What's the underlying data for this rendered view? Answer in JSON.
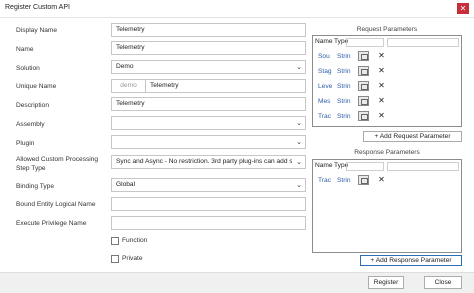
{
  "window": {
    "title": "Register Custom API",
    "close_symbol": "✕"
  },
  "form": {
    "display_name": {
      "label": "Display Name",
      "value": "Telemetry"
    },
    "name": {
      "label": "Name",
      "value": "Telemetry"
    },
    "solution": {
      "label": "Solution",
      "value": "Demo"
    },
    "unique_name": {
      "label": "Unique Name",
      "prefix": "demo",
      "value": "Telemetry"
    },
    "description": {
      "label": "Description",
      "value": "Telemetry"
    },
    "assembly": {
      "label": "Assembly",
      "value": ""
    },
    "plugin": {
      "label": "Plugin",
      "value": ""
    },
    "processing_step": {
      "label_line1": "Allowed Custom Processing",
      "label_line2": "Step Type",
      "value": "Sync and Async - No restriction. 3rd party plug-ins can add s"
    },
    "binding_type": {
      "label": "Binding Type",
      "value": "Global"
    },
    "bound_entity": {
      "label": "Bound Entity Logical Name",
      "value": ""
    },
    "execute_privilege": {
      "label": "Execute Privilege Name",
      "value": ""
    },
    "function": {
      "label": "Function",
      "checked": false
    },
    "private": {
      "label": "Private",
      "checked": false
    }
  },
  "request_parameters": {
    "title": "Request Parameters",
    "col_name": "Name",
    "col_type": "Type",
    "rows": [
      {
        "name": "Sou",
        "type": "Strin"
      },
      {
        "name": "Stag",
        "type": "Strin"
      },
      {
        "name": "Leve",
        "type": "Strin"
      },
      {
        "name": "Mes",
        "type": "Strin"
      },
      {
        "name": "Trac",
        "type": "Strin"
      }
    ],
    "add_label": "+ Add Request Parameter"
  },
  "response_parameters": {
    "title": "Response Parameters",
    "col_name": "Name",
    "col_type": "Type",
    "rows": [
      {
        "name": "Trac",
        "type": "Strin"
      }
    ],
    "add_label": "+ Add Response Parameter"
  },
  "footer": {
    "register_label": "Register",
    "close_label": "Close"
  },
  "icons": {
    "chevron": "⌄",
    "delete": "✕",
    "edit": "edit-icon"
  },
  "colors": {
    "close_button": "#c62f3a",
    "link_blue": "#2d5fa7"
  }
}
